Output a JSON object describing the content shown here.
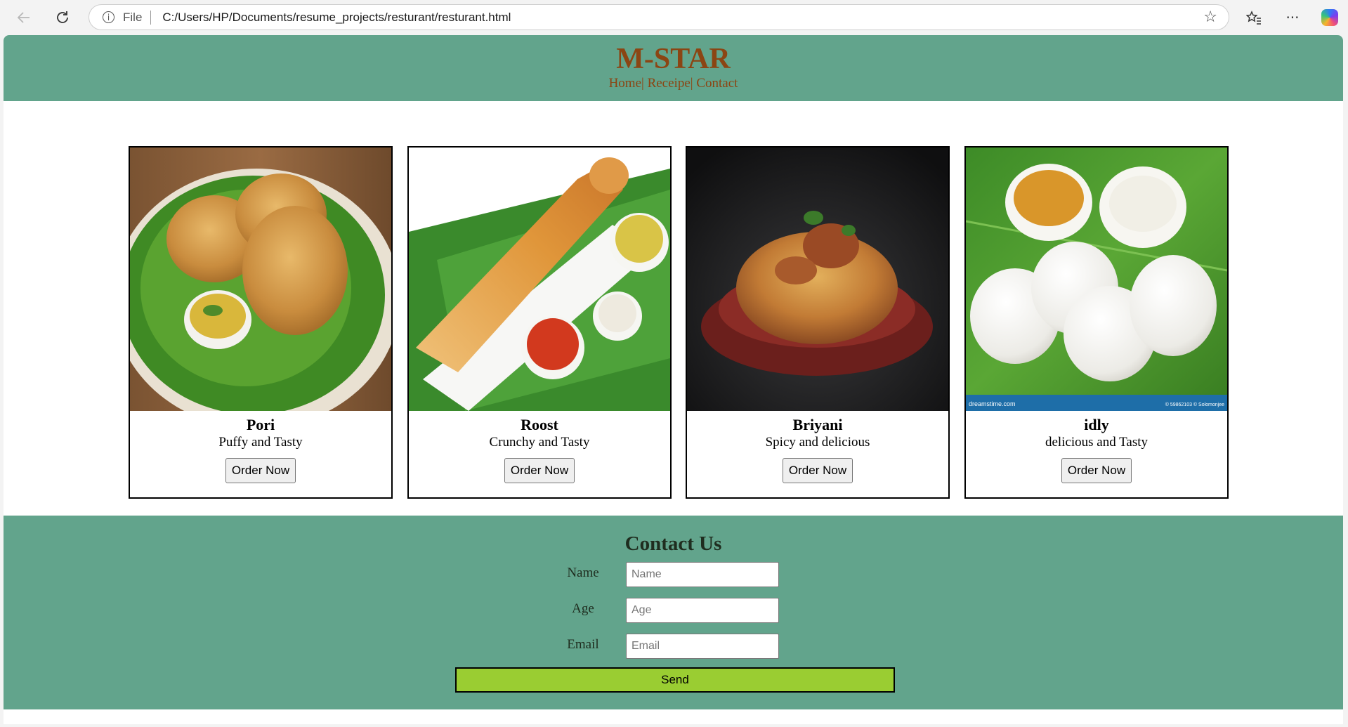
{
  "browser": {
    "scheme_label": "File",
    "url": "C:/Users/HP/Documents/resume_projects/resturant/resturant.html",
    "icons": [
      "back-arrow-icon",
      "refresh-icon",
      "info-icon",
      "star-icon",
      "favorites-icon",
      "more-icon",
      "copilot-icon"
    ]
  },
  "header": {
    "brand": "M-STAR",
    "nav": [
      {
        "label": "Home"
      },
      {
        "label": "Receipe"
      },
      {
        "label": "Contact"
      }
    ],
    "separator": "|",
    "background": "#62a48c",
    "text_color": "#8b4513"
  },
  "cards": [
    {
      "name": "Pori",
      "desc": "Puffy and Tasty",
      "button": "Order Now",
      "image": "poori-plate-photo"
    },
    {
      "name": "Roost",
      "desc": "Crunchy and Tasty",
      "button": "Order Now",
      "image": "dosa-plate-photo"
    },
    {
      "name": "Briyani",
      "desc": "Spicy and delicious",
      "button": "Order Now",
      "image": "biryani-bowl-photo"
    },
    {
      "name": "idly",
      "desc": "delicious and Tasty",
      "button": "Order Now",
      "image": "idli-plate-photo",
      "watermark_left": "dreamstime.com",
      "watermark_right": "© 59862103 © Solomonjee"
    }
  ],
  "contact": {
    "title": "Contact Us",
    "fields": [
      {
        "label": "Name",
        "placeholder": "Name"
      },
      {
        "label": "Age",
        "placeholder": "Age"
      },
      {
        "label": "Email",
        "placeholder": "Email"
      }
    ],
    "send_label": "Send",
    "send_color": "#9acd32"
  }
}
